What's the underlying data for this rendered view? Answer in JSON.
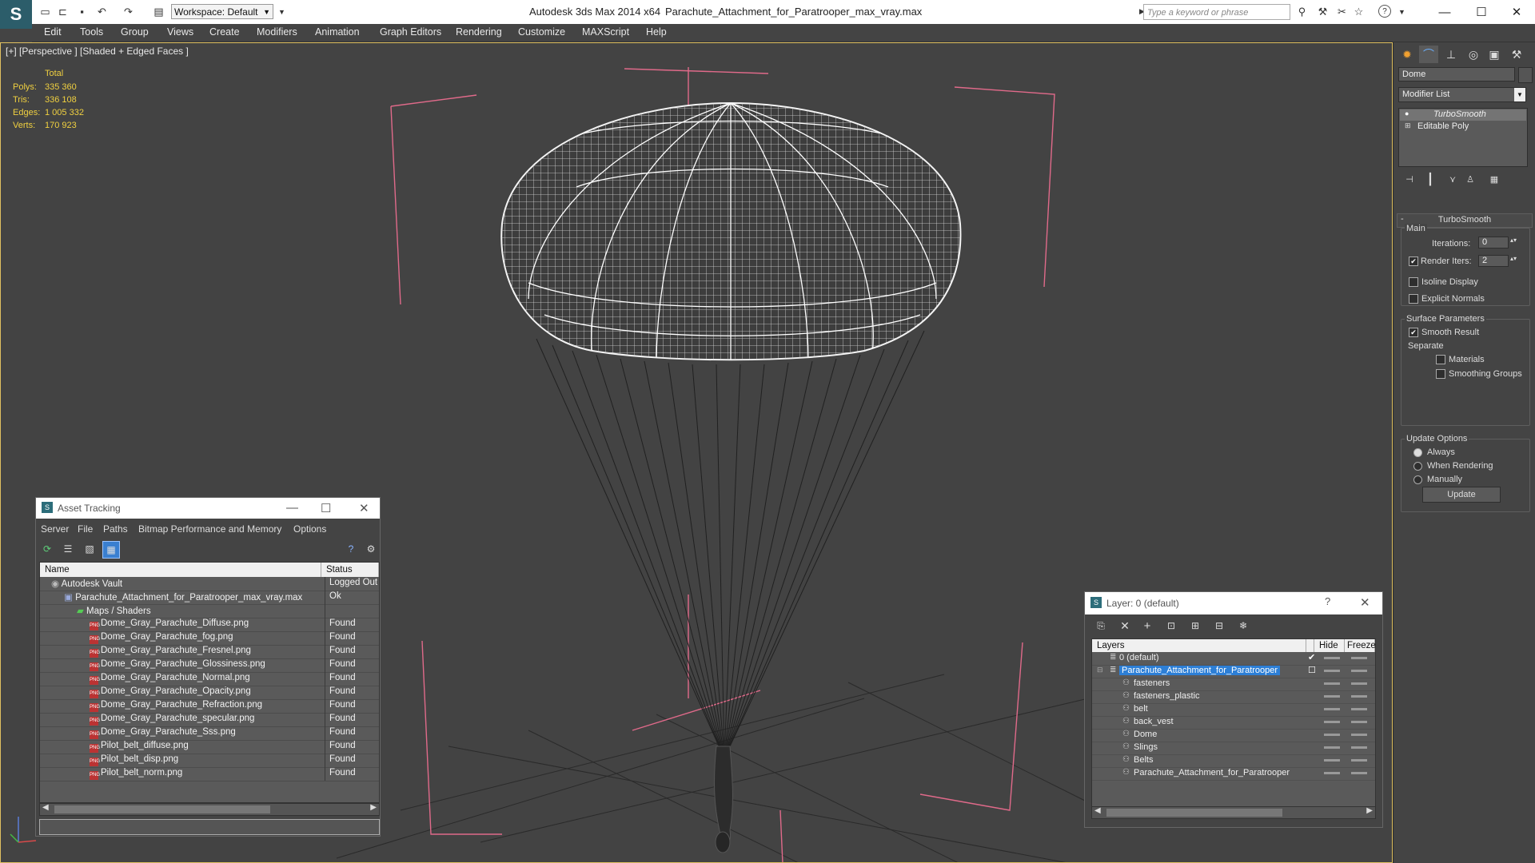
{
  "titlebar": {
    "app": "Autodesk 3ds Max  2014 x64",
    "file": "Parachute_Attachment_for_Paratrooper_max_vray.max",
    "workspace": "Workspace: Default",
    "search_placeholder": "Type a keyword or phrase"
  },
  "menu": [
    "Edit",
    "Tools",
    "Group",
    "Views",
    "Create",
    "Modifiers",
    "Animation",
    "Graph Editors",
    "Rendering",
    "Customize",
    "MAXScript",
    "Help"
  ],
  "viewport": {
    "label": "[+] [Perspective ] [Shaded + Edged Faces ]",
    "stats": {
      "header": "Total",
      "rows": [
        {
          "k": "Polys:",
          "v": "335 360"
        },
        {
          "k": "Tris:",
          "v": "336 108"
        },
        {
          "k": "Edges:",
          "v": "1 005 332"
        },
        {
          "k": "Verts:",
          "v": "170 923"
        }
      ]
    }
  },
  "command_panel": {
    "object_name": "Dome",
    "modifier_list": "Modifier List",
    "stack": [
      "TurboSmooth",
      "Editable Poly"
    ],
    "rollout": "TurboSmooth",
    "main": "Main",
    "iterations_label": "Iterations:",
    "iterations": "0",
    "render_iters_label": "Render Iters:",
    "render_iters": "2",
    "isoline": "Isoline Display",
    "explicit_normals": "Explicit Normals",
    "surface_params": "Surface Parameters",
    "smooth_result": "Smooth Result",
    "separate": "Separate",
    "materials": "Materials",
    "smoothing_groups": "Smoothing Groups",
    "update_options": "Update Options",
    "always": "Always",
    "when_rendering": "When Rendering",
    "manually": "Manually",
    "update": "Update"
  },
  "asset_tracking": {
    "title": "Asset Tracking",
    "menu": [
      "Server",
      "File",
      "Paths",
      "Bitmap Performance and Memory",
      "Options"
    ],
    "col_name": "Name",
    "col_status": "Status",
    "rows": [
      {
        "name": "Autodesk Vault",
        "status": "Logged Out",
        "indent": 0,
        "icon": "vault"
      },
      {
        "name": "Parachute_Attachment_for_Paratrooper_max_vray.max",
        "status": "Ok",
        "indent": 1,
        "icon": "max"
      },
      {
        "name": "Maps / Shaders",
        "status": "",
        "indent": 2,
        "icon": "maps"
      },
      {
        "name": "Dome_Gray_Parachute_Diffuse.png",
        "status": "Found",
        "indent": 3,
        "icon": "png"
      },
      {
        "name": "Dome_Gray_Parachute_fog.png",
        "status": "Found",
        "indent": 3,
        "icon": "png"
      },
      {
        "name": "Dome_Gray_Parachute_Fresnel.png",
        "status": "Found",
        "indent": 3,
        "icon": "png"
      },
      {
        "name": "Dome_Gray_Parachute_Glossiness.png",
        "status": "Found",
        "indent": 3,
        "icon": "png"
      },
      {
        "name": "Dome_Gray_Parachute_Normal.png",
        "status": "Found",
        "indent": 3,
        "icon": "png"
      },
      {
        "name": "Dome_Gray_Parachute_Opacity.png",
        "status": "Found",
        "indent": 3,
        "icon": "png"
      },
      {
        "name": "Dome_Gray_Parachute_Refraction.png",
        "status": "Found",
        "indent": 3,
        "icon": "png"
      },
      {
        "name": "Dome_Gray_Parachute_specular.png",
        "status": "Found",
        "indent": 3,
        "icon": "png"
      },
      {
        "name": "Dome_Gray_Parachute_Sss.png",
        "status": "Found",
        "indent": 3,
        "icon": "png"
      },
      {
        "name": "Pilot_belt_diffuse.png",
        "status": "Found",
        "indent": 3,
        "icon": "png"
      },
      {
        "name": "Pilot_belt_disp.png",
        "status": "Found",
        "indent": 3,
        "icon": "png"
      },
      {
        "name": "Pilot_belt_norm.png",
        "status": "Found",
        "indent": 3,
        "icon": "png"
      }
    ]
  },
  "layer_window": {
    "title": "Layer: 0 (default)",
    "col_layers": "Layers",
    "col_hide": "Hide",
    "col_freeze": "Freeze",
    "rows": [
      {
        "name": "0 (default)",
        "indent": 0,
        "selected": false
      },
      {
        "name": "Parachute_Attachment_for_Paratrooper",
        "indent": 0,
        "selected": true
      },
      {
        "name": "fasteners",
        "indent": 1,
        "selected": false
      },
      {
        "name": "fasteners_plastic",
        "indent": 1,
        "selected": false
      },
      {
        "name": "belt",
        "indent": 1,
        "selected": false
      },
      {
        "name": "back_vest",
        "indent": 1,
        "selected": false
      },
      {
        "name": "Dome",
        "indent": 1,
        "selected": false
      },
      {
        "name": "Slings",
        "indent": 1,
        "selected": false
      },
      {
        "name": "Belts",
        "indent": 1,
        "selected": false
      },
      {
        "name": "Parachute_Attachment_for_Paratrooper",
        "indent": 1,
        "selected": false
      }
    ]
  }
}
